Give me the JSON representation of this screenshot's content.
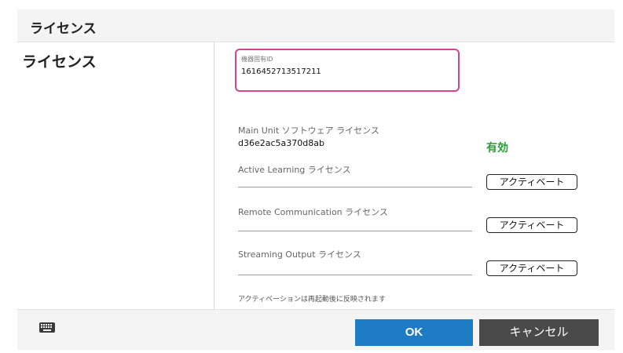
{
  "window": {
    "title": "ライセンス"
  },
  "sidebar": {
    "section_title": "ライセンス"
  },
  "device": {
    "caption": "機器固有ID",
    "id": "1616452713517211"
  },
  "licenses": {
    "main_unit": {
      "label": "Main Unit ソフトウェア ライセンス",
      "key": "d36e2ac5a370d8ab",
      "status": "有効"
    },
    "active_learning": {
      "label": "Active Learning ライセンス",
      "button": "アクティベート"
    },
    "remote_communication": {
      "label": "Remote Communication ライセンス",
      "button": "アクティベート"
    },
    "streaming_output": {
      "label": "Streaming Output ライセンス",
      "button": "アクティベート"
    }
  },
  "note": "アクティベーションは再起動後に反映されます",
  "footer": {
    "keyboard_icon": "keyboard-icon",
    "ok_label": "OK",
    "cancel_label": "キャンセル"
  },
  "colors": {
    "highlight_border": "#d04590",
    "valid_status": "#2a9d3a",
    "ok_button": "#1d7cc4",
    "cancel_button": "#4a4a4a"
  }
}
